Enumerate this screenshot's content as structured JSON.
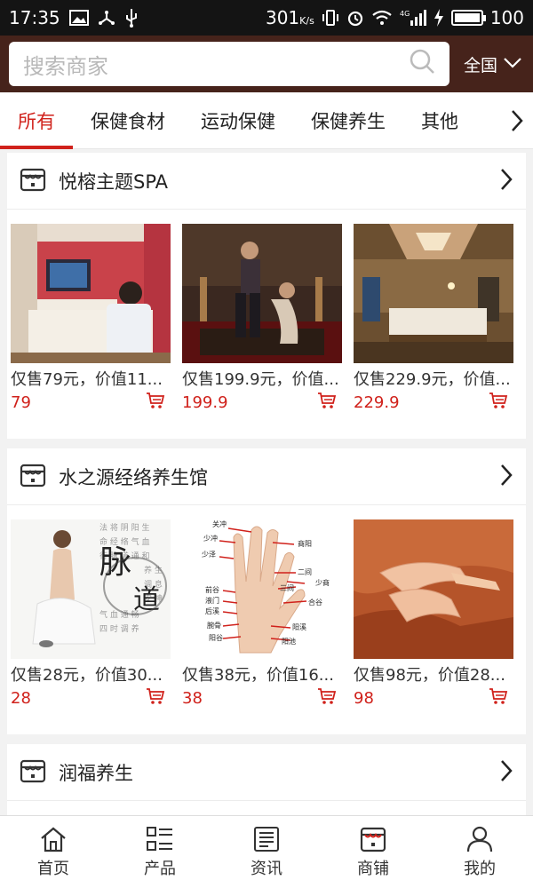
{
  "status_bar": {
    "time": "17:35",
    "speed": "301",
    "speed_unit": "K/s",
    "network": "4G",
    "battery": "100",
    "battery_level": 1.0
  },
  "search": {
    "placeholder": "搜索商家",
    "region": "全国"
  },
  "tabs": [
    {
      "label": "所有",
      "active": true
    },
    {
      "label": "保健食材",
      "active": false
    },
    {
      "label": "运动保健",
      "active": false
    },
    {
      "label": "保健养生",
      "active": false
    },
    {
      "label": "其他",
      "active": false
    }
  ],
  "shops": [
    {
      "name": "悦榕主题SPA",
      "products": [
        {
          "desc": "仅售79元，价值11...",
          "price": "79"
        },
        {
          "desc": "仅售199.9元，价值...",
          "price": "199.9"
        },
        {
          "desc": "仅售229.9元，价值...",
          "price": "229.9"
        }
      ]
    },
    {
      "name": "水之源经络养生馆",
      "products": [
        {
          "desc": "仅售28元，价值30...",
          "price": "28"
        },
        {
          "desc": "仅售38元，价值16...",
          "price": "38"
        },
        {
          "desc": "仅售98元，价值28...",
          "price": "98"
        }
      ]
    },
    {
      "name": "润福养生",
      "products": []
    }
  ],
  "image_text": {
    "brand_char_1": "脉",
    "brand_char_2": "道",
    "points": [
      "关冲",
      "少冲",
      "少泽",
      "商阳",
      "二间",
      "少商",
      "三间",
      "合谷",
      "前谷",
      "液门",
      "后溪",
      "腕骨",
      "阳谷",
      "阳溪",
      "阳池"
    ]
  },
  "bottom_nav": [
    {
      "label": "首页",
      "icon": "home-icon"
    },
    {
      "label": "产品",
      "icon": "grid-list-icon"
    },
    {
      "label": "资讯",
      "icon": "news-icon"
    },
    {
      "label": "商铺",
      "icon": "store-icon",
      "active": true
    },
    {
      "label": "我的",
      "icon": "user-icon"
    }
  ],
  "colors": {
    "accent": "#d0211b",
    "header_bg": "#46231b",
    "status_bg": "#141414"
  }
}
